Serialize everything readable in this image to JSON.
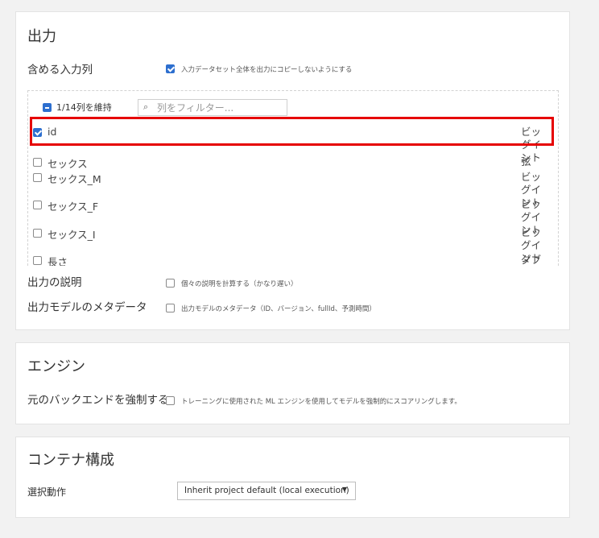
{
  "output": {
    "title": "出力",
    "include_columns_label": "含める入力列",
    "no_copy_label": "入力データセット全体を出力にコピーしないようにする",
    "keep_label": "1/14列を維持",
    "filter_placeholder": "列をフィルター...",
    "columns": [
      {
        "name": "id",
        "type": "ビッグイント",
        "checked": true
      },
      {
        "name": "セックス",
        "type": "弦",
        "checked": false
      },
      {
        "name": "セックス_M",
        "type": "ビッグイント",
        "checked": false
      },
      {
        "name": "セックス_F",
        "type": "ビッグイント",
        "checked": false
      },
      {
        "name": "セックス_I",
        "type": "ビッグイント",
        "checked": false
      },
      {
        "name": "長さ",
        "type": "ダブル",
        "checked": false
      }
    ],
    "explanation_label": "出力の説明",
    "explanation_option": "個々の説明を計算する（かなり遅い）",
    "metadata_label": "出力モデルのメタデータ",
    "metadata_option": "出力モデルのメタデータ（ID、バージョン、fullId、予測時間）"
  },
  "engine": {
    "title": "エンジン",
    "force_backend_label": "元のバックエンドを強制する",
    "force_backend_option": "トレーニングに使用された ML エンジンを使用してモデルを強制的にスコアリングします。"
  },
  "container": {
    "title": "コンテナ構成",
    "selection_label": "選択動作",
    "selection_value": "Inherit project default (local execution)"
  },
  "colors": {
    "accent": "#2d6fcf",
    "highlight": "#e60000"
  }
}
